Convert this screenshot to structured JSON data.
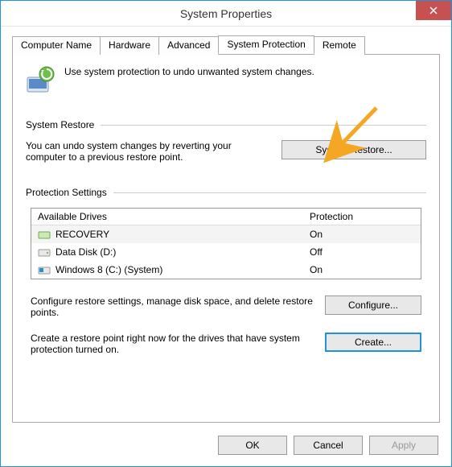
{
  "window": {
    "title": "System Properties"
  },
  "tabs": {
    "computer_name": "Computer Name",
    "hardware": "Hardware",
    "advanced": "Advanced",
    "system_protection": "System Protection",
    "remote": "Remote"
  },
  "intro_text": "Use system protection to undo unwanted system changes.",
  "sections": {
    "system_restore": "System Restore",
    "protection_settings": "Protection Settings"
  },
  "restore": {
    "description": "You can undo system changes by reverting your computer to a previous restore point.",
    "button": "System Restore..."
  },
  "drives": {
    "header_drives": "Available Drives",
    "header_protection": "Protection",
    "rows": [
      {
        "name": "RECOVERY",
        "protection": "On",
        "icon": "drive-green"
      },
      {
        "name": "Data Disk (D:)",
        "protection": "Off",
        "icon": "drive"
      },
      {
        "name": "Windows 8 (C:) (System)",
        "protection": "On",
        "icon": "drive-win"
      }
    ]
  },
  "configure": {
    "description": "Configure restore settings, manage disk space, and delete restore points.",
    "button": "Configure..."
  },
  "create": {
    "description": "Create a restore point right now for the drives that have system protection turned on.",
    "button": "Create..."
  },
  "buttons": {
    "ok": "OK",
    "cancel": "Cancel",
    "apply": "Apply"
  }
}
